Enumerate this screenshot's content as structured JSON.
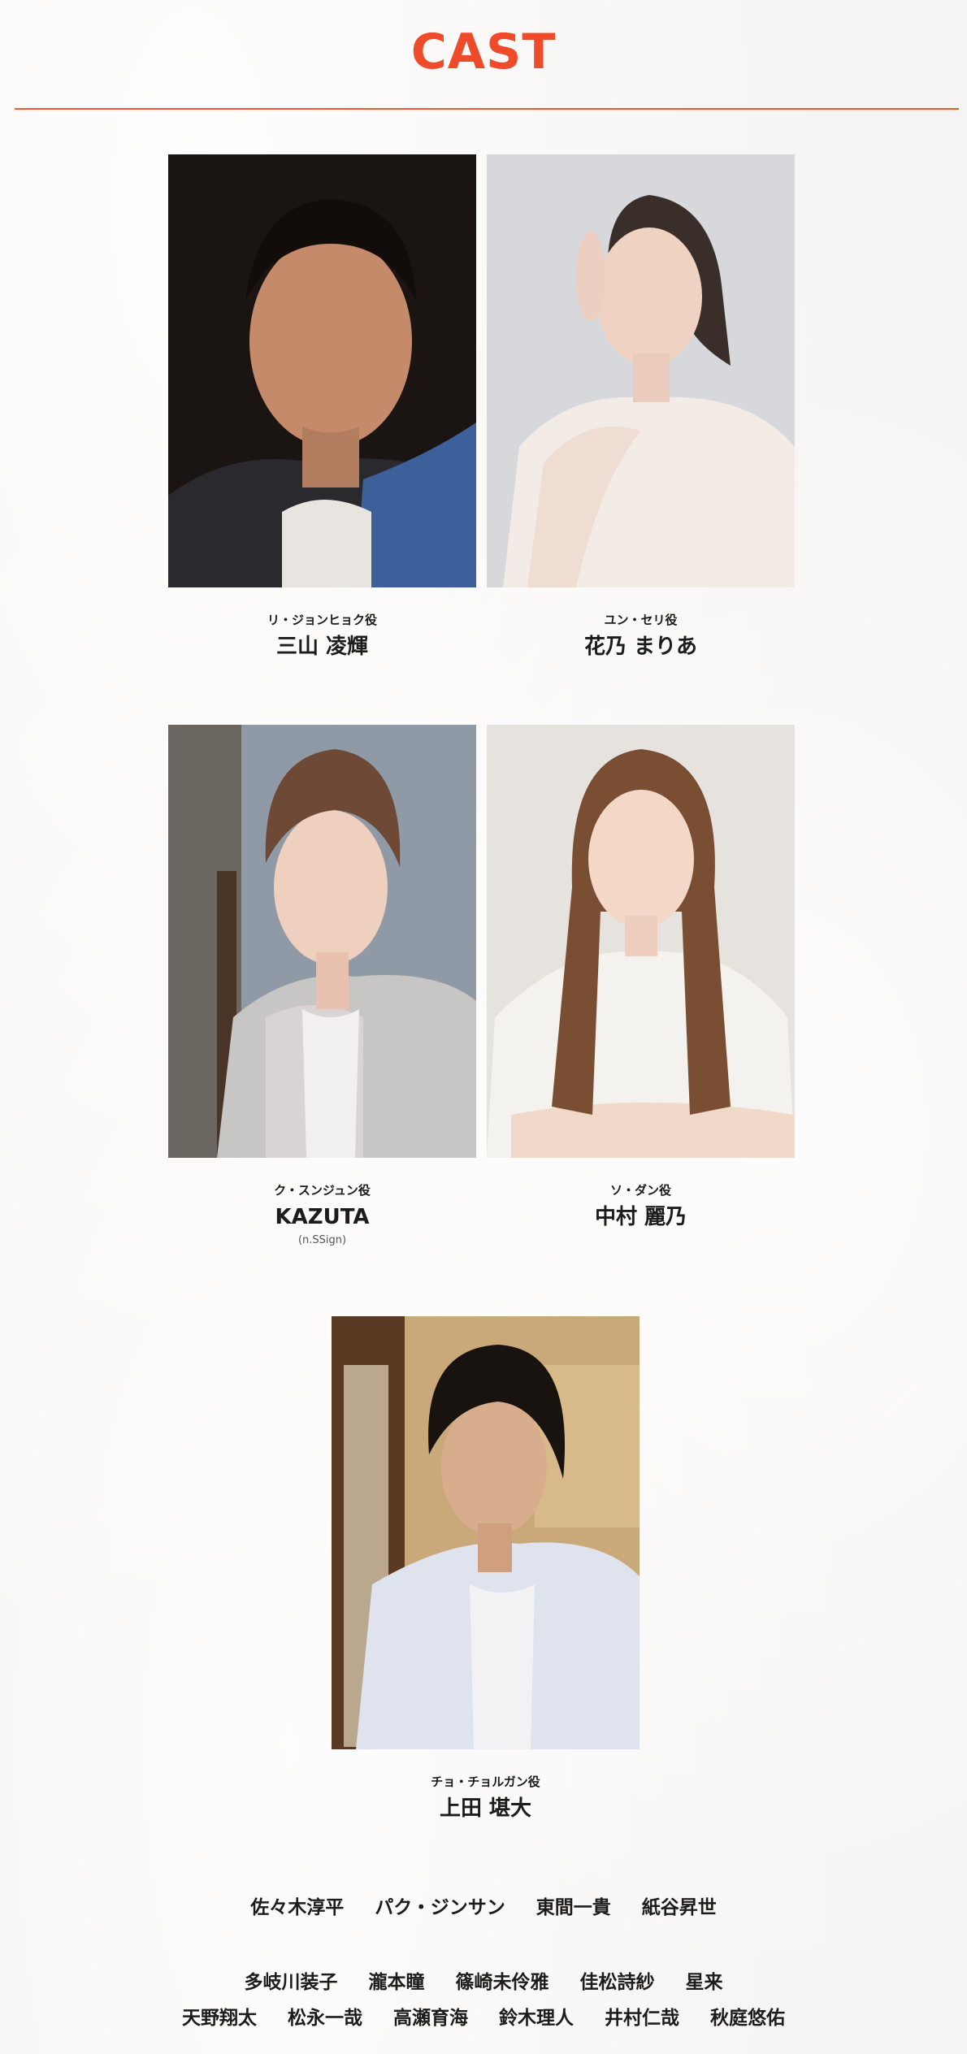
{
  "title": "CAST",
  "cast": [
    {
      "role": "リ・ジョンヒョク役",
      "name": "三山 凌輝",
      "photo": "cast-photo"
    },
    {
      "role": "ユン・セリ役",
      "name": "花乃 まりあ",
      "photo": "cast-photo"
    },
    {
      "role": "ク・スンジュン役",
      "name": "KAZUTA",
      "note": "(n.SSign)",
      "photo": "cast-photo"
    },
    {
      "role": "ソ・ダン役",
      "name": "中村 麗乃",
      "photo": "cast-photo"
    },
    {
      "role": "チョ・チョルガン役",
      "name": "上田 堪大",
      "photo": "cast-photo"
    }
  ],
  "others": {
    "row1": [
      "佐々木淳平",
      "パク・ジンサン",
      "東間一貴",
      "紙谷昇世"
    ],
    "row2": [
      "多岐川装子",
      "瀧本瞳",
      "篠崎未伶雅",
      "佳松詩紗",
      "星来"
    ],
    "row3": [
      "天野翔太",
      "松永一哉",
      "高瀬育海",
      "鈴木理人",
      "井村仁哉",
      "秋庭悠佑"
    ]
  }
}
